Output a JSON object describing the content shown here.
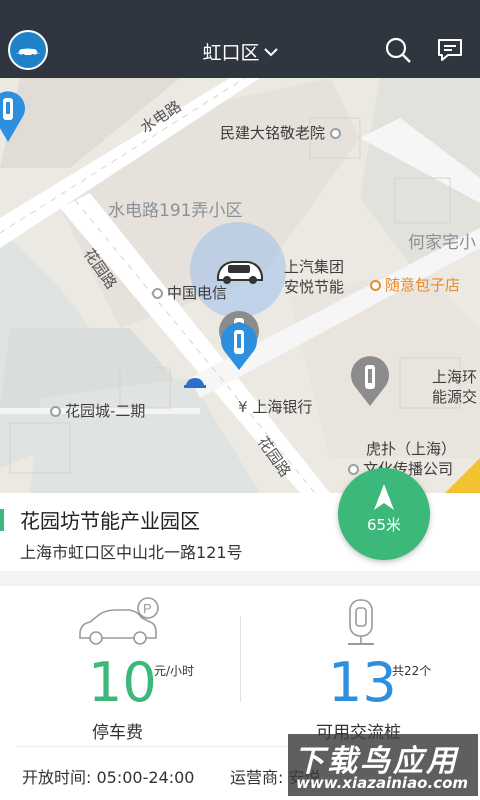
{
  "header": {
    "district": "虹口区",
    "icons": [
      "app-logo-icon",
      "search-icon",
      "message-icon"
    ]
  },
  "map": {
    "roads": [
      "水电路",
      "花园路",
      "花园路"
    ],
    "labels": {
      "area_big": "水电路191弄小区",
      "area_right": "何家宅小",
      "minjian": "民建大铭敬老院",
      "china_telecom": "中国电信",
      "saic": "上汽集团",
      "anyue": "安悦节能",
      "suiyi": "随意包子店",
      "bank": "上海银行",
      "huayuan": "花园城-二期",
      "hupu1": "虎扑（上海）",
      "hupu2": "文化传播公司",
      "shhuan1": "上海环",
      "shhuan2": "能源交"
    }
  },
  "nav": {
    "distance": "65米"
  },
  "address": {
    "title": "花园坊节能产业园区",
    "subtitle": "上海市虹口区中山北一路121号"
  },
  "parking": {
    "value": "10",
    "unit": "元/小时",
    "label": "停车费"
  },
  "chargers": {
    "value": "13",
    "total": "共22个",
    "label": "可用交流桩"
  },
  "footer": {
    "hours": "开放时间: 05:00-24:00",
    "operator": "运营商: 安悦"
  },
  "watermark": {
    "top": "下载鸟应用",
    "bottom": "www.xiazainiao.com"
  },
  "colors": {
    "header": "#2f3640",
    "accent_green": "#3bb87a",
    "accent_blue": "#2d8fe0",
    "pin_blue": "#2d8fe0"
  }
}
